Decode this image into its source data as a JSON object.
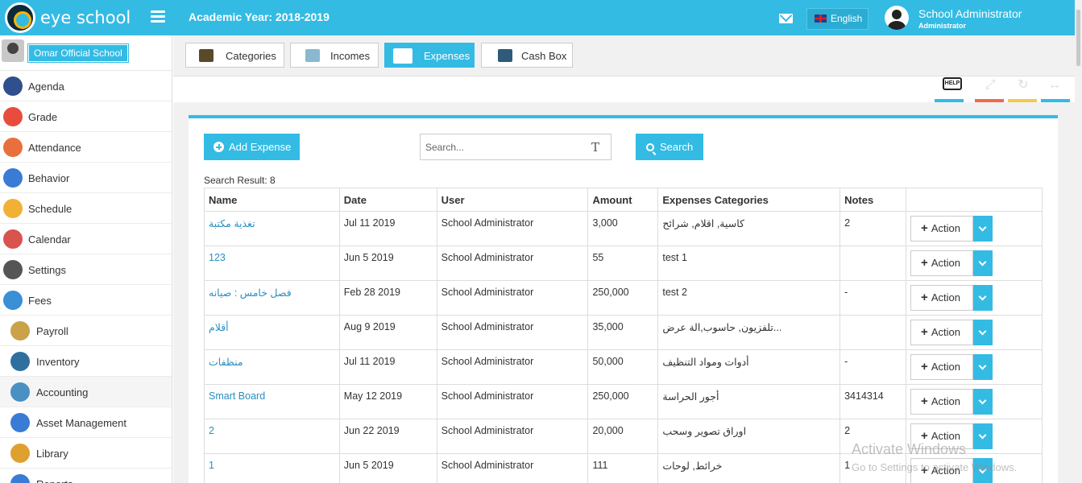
{
  "header": {
    "brand": "eye school",
    "academic_year": "Academic Year: 2018-2019",
    "language": "English",
    "user_name": "School Administrator",
    "user_role": "Administrator",
    "accent": "#33bbe4"
  },
  "sidebar": {
    "school_name": "Omar Official School",
    "items": [
      {
        "label": "Agenda",
        "icon": "agenda-icon"
      },
      {
        "label": "Grade",
        "icon": "grade-icon"
      },
      {
        "label": "Attendance",
        "icon": "attendance-icon"
      },
      {
        "label": "Behavior",
        "icon": "behavior-icon"
      },
      {
        "label": "Schedule",
        "icon": "schedule-icon"
      },
      {
        "label": "Calendar",
        "icon": "calendar-icon"
      },
      {
        "label": "Settings",
        "icon": "settings-icon"
      },
      {
        "label": "Fees",
        "icon": "fees-icon"
      },
      {
        "label": "Payroll",
        "icon": "payroll-icon"
      },
      {
        "label": "Inventory",
        "icon": "inventory-icon"
      },
      {
        "label": "Accounting",
        "icon": "accounting-icon"
      },
      {
        "label": "Asset Management",
        "icon": "asset-management-icon"
      },
      {
        "label": "Library",
        "icon": "library-icon"
      },
      {
        "label": "Reports",
        "icon": "reports-icon"
      }
    ]
  },
  "tabs": [
    {
      "label": "Categories"
    },
    {
      "label": "Incomes"
    },
    {
      "label": "Expenses",
      "active": true
    },
    {
      "label": "Cash Box"
    }
  ],
  "toolbar": {
    "help_label": "HELP"
  },
  "actions": {
    "add_label": "Add Expense",
    "search_placeholder": "Search...",
    "search_label": "Search",
    "result_text": "Search Result: 8"
  },
  "table": {
    "columns": [
      "Name",
      "Date",
      "User",
      "Amount",
      "Expenses Categories",
      "Notes",
      ""
    ],
    "action_label": "Action",
    "rows": [
      {
        "name": "تغذية مكتبة",
        "date": "Jul 11 2019",
        "user": "School Administrator",
        "amount": "3,000",
        "category": "كاسية, اقلام, شرائح",
        "notes": "2"
      },
      {
        "name": "123",
        "date": "Jun 5 2019",
        "user": "School Administrator",
        "amount": "55",
        "category": "test 1",
        "notes": ""
      },
      {
        "name": "فصل خامس : صيانه",
        "date": "Feb 28 2019",
        "user": "School Administrator",
        "amount": "250,000",
        "category": "test 2",
        "notes": "-"
      },
      {
        "name": "أقلام",
        "date": "Aug 9 2019",
        "user": "School Administrator",
        "amount": "35,000",
        "category": "تلفزيون, حاسوب,الة عرض...",
        "notes": ""
      },
      {
        "name": "منظفات",
        "date": "Jul 11 2019",
        "user": "School Administrator",
        "amount": "50,000",
        "category": "أدوات ومواد التنظيف",
        "notes": "-"
      },
      {
        "name": "Smart Board",
        "date": "May 12 2019",
        "user": "School Administrator",
        "amount": "250,000",
        "category": "أجور الحراسة",
        "notes": "3414314"
      },
      {
        "name": "2",
        "date": "Jun 22 2019",
        "user": "School Administrator",
        "amount": "20,000",
        "category": "اوراق تصوير وسحب",
        "notes": "2"
      },
      {
        "name": "1",
        "date": "Jun 5 2019",
        "user": "School Administrator",
        "amount": "111",
        "category": "خرائط, لوحات",
        "notes": "1"
      }
    ]
  },
  "watermark": {
    "line1": "Activate Windows",
    "line2": "Go to Settings to activate Windows."
  }
}
